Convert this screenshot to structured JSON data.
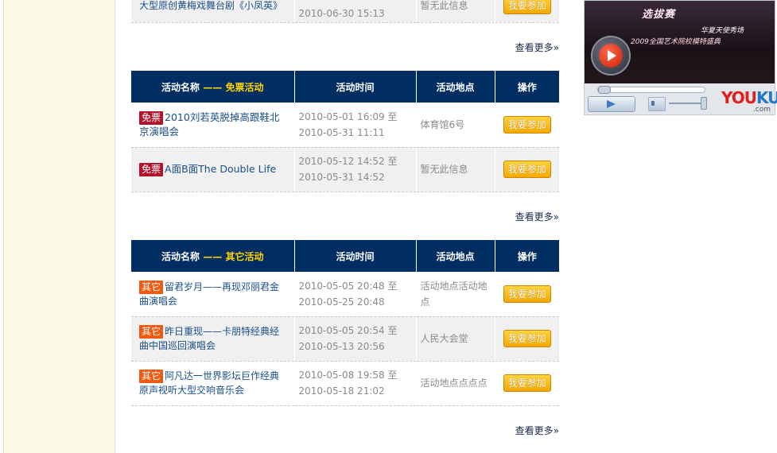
{
  "top_partial": {
    "name": "大型原创黄梅戏舞台剧《小凤英》",
    "time": "2010-06-30 15:13",
    "place": "暂无此信息",
    "join_label": "我要参加"
  },
  "more_label": "查看更多»",
  "free_section": {
    "headers": {
      "name": "活动名称",
      "sep": "——",
      "category": "免票活动",
      "time": "活动时间",
      "place": "活动地点",
      "op": "操作"
    },
    "rows": [
      {
        "badge": "免票",
        "name": "2010刘若英脱掉高跟鞋北京演唱会",
        "time_start": "2010-05-01 16:09 至",
        "time_end": "2010-05-31 11:11",
        "place": "体育馆6号",
        "join_label": "我要参加"
      },
      {
        "badge": "免票",
        "name": "A面B面The Double Life",
        "time_start": "2010-05-12 14:52 至",
        "time_end": "2010-05-31 14:52",
        "place": "暂无此信息",
        "join_label": "我要参加"
      }
    ]
  },
  "other_section": {
    "headers": {
      "name": "活动名称",
      "sep": "——",
      "category": "其它活动",
      "time": "活动时间",
      "place": "活动地点",
      "op": "操作"
    },
    "rows": [
      {
        "badge": "其它",
        "name": "留君岁月——再现邓丽君金曲演唱会",
        "time_start": "2010-05-05 20:48 至",
        "time_end": "2010-05-25 20:48",
        "place": "活动地点活动地点",
        "join_label": "我要参加"
      },
      {
        "badge": "其它",
        "name": "昨日重现——卡朋特经典经曲中国巡回演唱会",
        "time_start": "2010-05-05 20:54 至",
        "time_end": "2010-05-13 20:56",
        "place": "人民大会堂",
        "join_label": "我要参加"
      },
      {
        "badge": "其它",
        "name": "阿凡达一世界影坛巨作经典原声视听大型交响音乐会",
        "time_start": "2010-05-08 19:58 至",
        "time_end": "2010-05-18 21:02",
        "place": "活动地点点点点",
        "join_label": "我要参加"
      }
    ]
  },
  "video_player": {
    "banner_title": "选拔赛",
    "banner_subtitle": "2009全国艺术院校模特盛典",
    "banner_right": "华夏天使秀场",
    "logo_you": "YOU",
    "logo_ku": "KU",
    "logo_com": ".com",
    "progress_fraction": 0.0
  },
  "colors": {
    "header_bg": "#002d62",
    "header_accent": "#ffd200",
    "free_badge": "#b3132b",
    "other_badge": "#ef5a10",
    "join_button": "#f5a800",
    "link": "#1a4f8a"
  }
}
